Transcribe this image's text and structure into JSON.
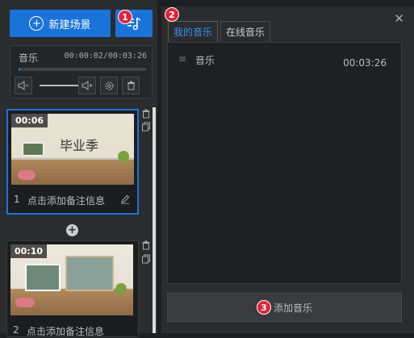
{
  "toolbar": {
    "new_scene_label": "新建场景",
    "badges": {
      "music": "1",
      "tab": "2",
      "add": "3"
    }
  },
  "audio": {
    "name": "音乐",
    "time": "00:00:02/00:03:26",
    "progress_fraction": 0.01,
    "volume_fraction": 0.85
  },
  "scenes": [
    {
      "index": "1",
      "duration": "00:06",
      "title": "毕业季",
      "caption": "点击添加备注信息",
      "selected": true
    },
    {
      "index": "2",
      "duration": "00:10",
      "title": "",
      "caption": "点击添加备注信息",
      "selected": false
    }
  ],
  "music_panel": {
    "tabs": [
      {
        "label": "我的音乐",
        "active": true
      },
      {
        "label": "在线音乐",
        "active": false
      }
    ],
    "items": [
      {
        "name": "音乐",
        "duration": "00:03:26"
      }
    ],
    "add_button_label": "添加音乐"
  },
  "icons": {
    "new_scene": "plus-circle-icon",
    "music": "music-note-icon",
    "volume_down": "volume-down-icon",
    "volume_up": "volume-up-icon",
    "settings": "gear-icon",
    "delete": "trash-icon",
    "copy": "copy-icon",
    "edit": "pencil-icon",
    "add_scene": "plus-icon",
    "close": "close-icon",
    "drag": "drag-handle-icon"
  },
  "colors": {
    "accent": "#1a73d9",
    "badge": "#e0243a",
    "active_tab": "#3b8df0"
  }
}
